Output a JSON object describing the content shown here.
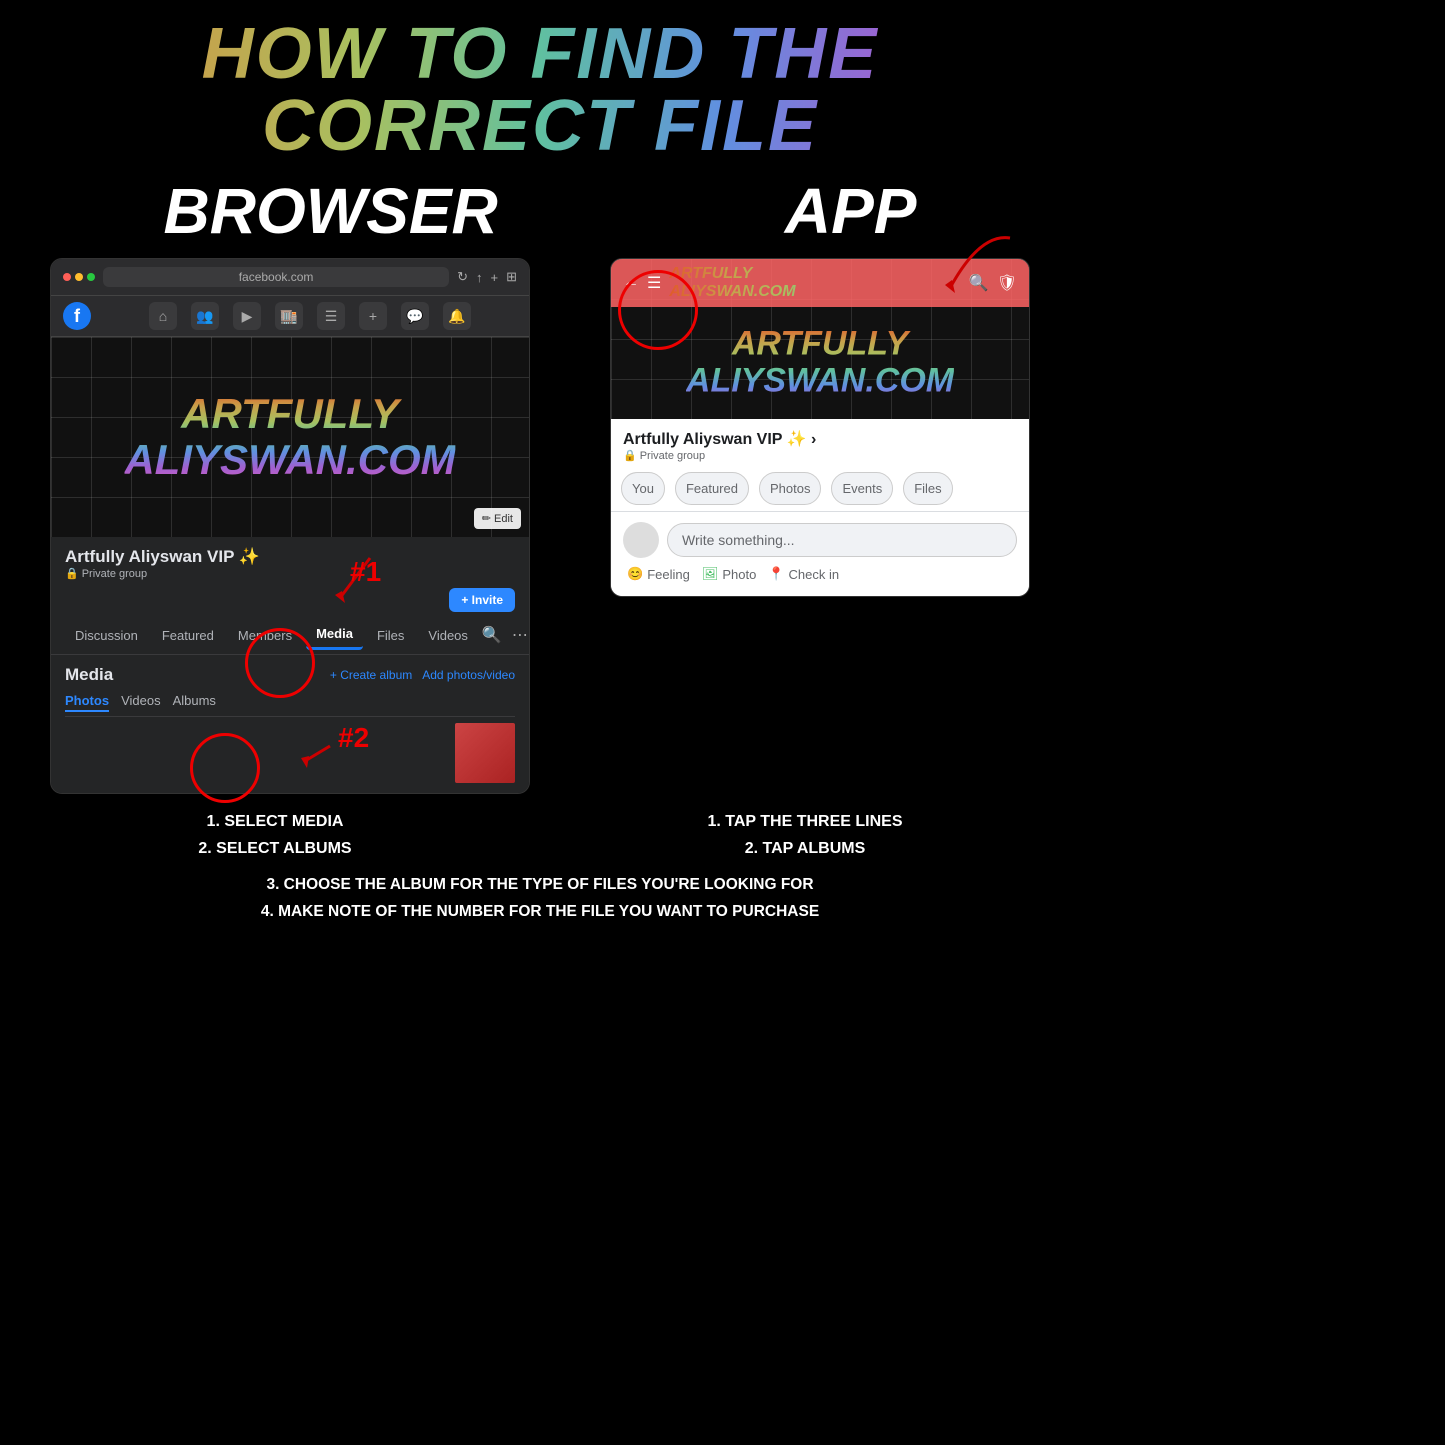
{
  "title": {
    "main": "HOW TO FIND THE CORRECT FILE"
  },
  "sections": {
    "browser_label": "BROWSER",
    "app_label": "APP"
  },
  "browser_mock": {
    "url": "facebook.com",
    "group_name": "Artfully Aliyswan VIP ✨",
    "group_type": "Private group",
    "cover_line1": "ARTFULLY",
    "cover_line2": "ALIYSWAN.COM",
    "edit_btn": "✏ Edit",
    "tabs": [
      "Discussion",
      "Featured",
      "Members",
      "Media",
      "Files",
      "Videos"
    ],
    "active_tab": "Media",
    "media_title": "Media",
    "create_album": "+ Create album",
    "add_photos": "Add photos/video",
    "sub_tabs": [
      "Photos",
      "Videos",
      "Albums"
    ],
    "active_sub_tab": "Photos",
    "annotation_1": "#1",
    "annotation_2": "#2",
    "invite_btn": "+ Invite"
  },
  "app_mock": {
    "group_name": "Artfully Aliyswan VIP ✨ ›",
    "group_type": "Private group",
    "cover_line1": "ARTFULLY",
    "cover_line2": "ALIYSWAN.COM",
    "bar_title": "ARTFULLY\nALIYSWAN.COM",
    "tabs": [
      "You",
      "Featured",
      "Photos",
      "Events",
      "Files"
    ],
    "post_placeholder": "Write something...",
    "actions": [
      "Feeling",
      "Photo",
      "Check in"
    ],
    "feeling_icon": "😊",
    "photo_icon": "🖼",
    "checkin_icon": "📍"
  },
  "instructions": {
    "browser_col": {
      "line1": "1. SELECT MEDIA",
      "line2": "2. SELECT ALBUMS"
    },
    "shared_lines": {
      "line3": "3. CHOOSE THE ALBUM FOR THE TYPE OF FILES YOU'RE LOOKING FOR",
      "line4": "4. MAKE NOTE OF THE NUMBER FOR THE FILE YOU WANT TO PURCHASE"
    },
    "app_col": {
      "line1": "1. TAP THE THREE LINES",
      "line2": "2. TAP ALBUMS"
    }
  }
}
